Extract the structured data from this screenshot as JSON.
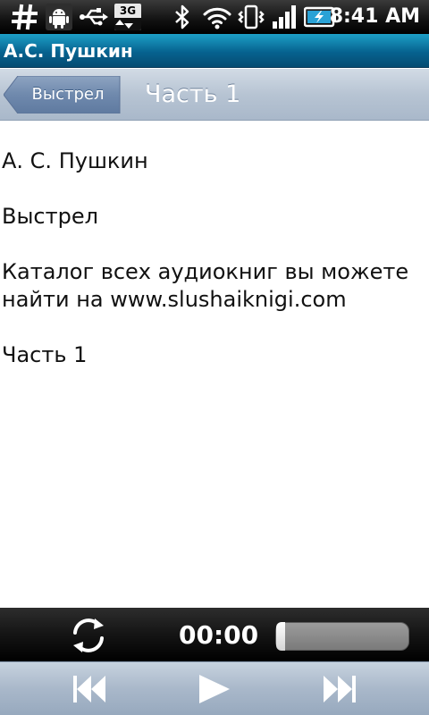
{
  "status_bar": {
    "time": "8:41 AM",
    "icons": [
      "hash-icon",
      "android-debug-icon",
      "usb-icon",
      "3g-icon",
      "bluetooth-icon",
      "wifi-icon",
      "vibrate-icon",
      "signal-icon",
      "battery-charging-icon"
    ],
    "network_label": "3G"
  },
  "titlebar": {
    "title": "А.С. Пушкин"
  },
  "navbar": {
    "back_label": "Выстрел",
    "title": "Часть 1"
  },
  "content": {
    "lines": [
      "А. С. Пушкин",
      "Выстрел",
      "Каталог всех аудиокниг вы можете найти на www.slushaiknigi.com",
      "Часть 1"
    ]
  },
  "player": {
    "time": "00:00",
    "progress": 0
  },
  "controls": {
    "icons": [
      "rewind-icon",
      "play-icon",
      "fast-forward-icon"
    ]
  },
  "colors": {
    "titlebar": "#06628f",
    "navbar": "#b7c4d3",
    "back_button": "#6d87aa"
  }
}
